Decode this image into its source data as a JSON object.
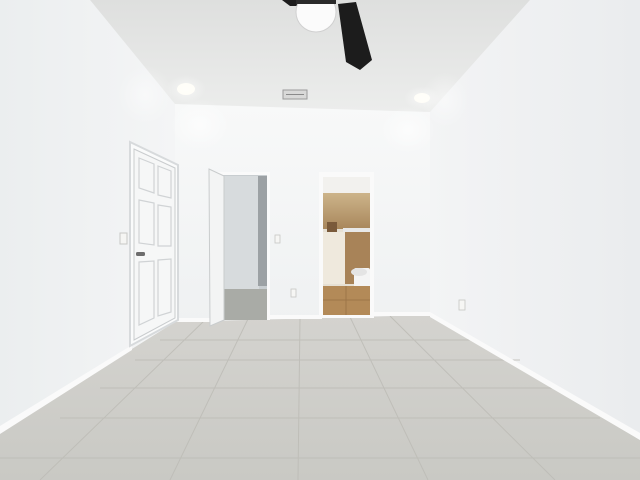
{
  "scene": {
    "description_label": "",
    "room": {
      "walls_color": "#eef0f1",
      "ceiling_color": "#e7e8e7",
      "floor_tile_color": "#cfcfcb",
      "baseboard_color": "#fbfbfb"
    },
    "ceiling_fan": {
      "light_color": "#fbfbfb",
      "blade_color": "#1b1b1b"
    },
    "doors": [
      {
        "name": "closet-door",
        "state": "closed"
      },
      {
        "name": "hall-door",
        "state": "open"
      },
      {
        "name": "bathroom-doorway",
        "state": "open"
      }
    ],
    "bathroom": {
      "tile_color": "#c7a66f",
      "floor_color": "#b8905f"
    }
  }
}
